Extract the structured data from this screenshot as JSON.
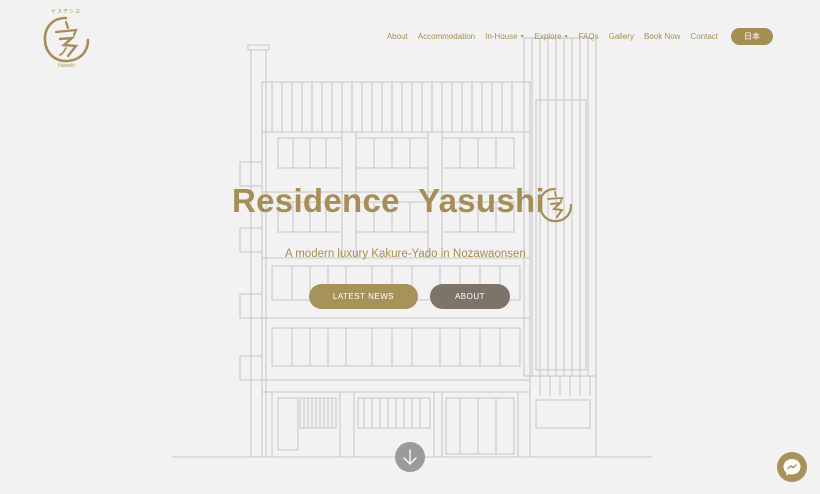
{
  "logo": {
    "kana": "ヤスヂシヨ",
    "name": "Yasushi"
  },
  "nav": {
    "items": [
      {
        "label": "About",
        "dropdown": false
      },
      {
        "label": "Accommodation",
        "dropdown": false
      },
      {
        "label": "In-House",
        "dropdown": true
      },
      {
        "label": "Explore",
        "dropdown": true
      },
      {
        "label": "FAQs",
        "dropdown": false
      },
      {
        "label": "Gallery",
        "dropdown": false
      },
      {
        "label": "Book Now",
        "dropdown": false
      },
      {
        "label": "Contact",
        "dropdown": false
      }
    ],
    "language": "日本"
  },
  "hero": {
    "title": "Residence  Yasushi",
    "subtitle": "A modern luxury Kakure-Yado in Nozawaonsen",
    "buttons": {
      "latest_news": "LATEST NEWS",
      "about": "ABOUT"
    }
  },
  "colors": {
    "accent": "#a68f54",
    "button_secondary": "#7e7368",
    "background": "#f2f2f2",
    "scroll_button": "#9b9b9b"
  },
  "icons": {
    "scroll": "arrow-down-icon",
    "chat": "messenger-icon"
  }
}
